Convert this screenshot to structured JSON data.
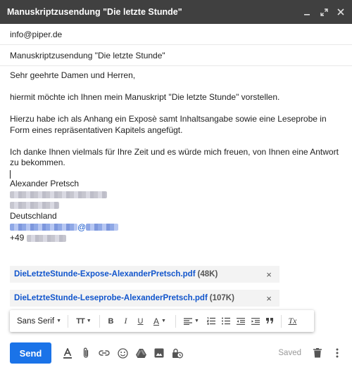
{
  "window": {
    "title": "Manuskriptzusendung \"Die letzte Stunde\""
  },
  "header": {
    "to": "info@piper.de",
    "subject": "Manuskriptzusendung \"Die letzte Stunde\""
  },
  "body": {
    "greeting": "Sehr geehrte Damen und Herren,",
    "p1": "hiermit möchte ich Ihnen mein Manuskript \"Die letzte Stunde\" vorstellen.",
    "p2": "Hierzu habe ich als Anhang ein Exposè samt Inhaltsangabe sowie eine Leseprobe in Form eines repräsentativen Kapitels angefügt.",
    "p3": "Ich danke Ihnen vielmals für Ihre Zeit und es würde mich freuen, von Ihnen eine Antwort zu bekommen.",
    "signature_name": "Alexander Pretsch",
    "country": "Deutschland",
    "email_visible": "@",
    "phone_prefix": "+49"
  },
  "attachments": [
    {
      "name": "DieLetzteStunde-Expose-AlexanderPretsch.pdf",
      "size": "(48K)",
      "remove": "×"
    },
    {
      "name": "DieLetzteStunde-Leseprobe-AlexanderPretsch.pdf",
      "size": "(107K)",
      "remove": "×"
    }
  ],
  "format_bar": {
    "font": "Sans Serif",
    "size_glyph": "TT",
    "bold": "B",
    "italic": "I",
    "underline": "U",
    "text_color": "A",
    "clear": "Tx"
  },
  "bottom": {
    "send": "Send",
    "saved": "Saved"
  },
  "colors": {
    "titlebar": "#404040",
    "send": "#1a73e8",
    "link": "#1155cc",
    "attachment_bg": "#f3f3f3"
  }
}
